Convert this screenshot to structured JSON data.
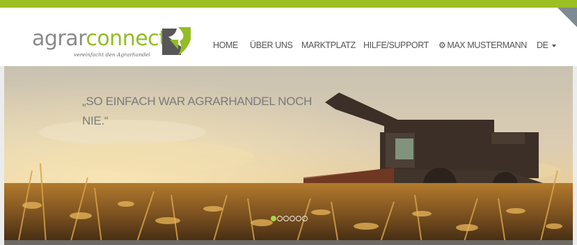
{
  "brand": {
    "name_part1": "agrar",
    "name_part2": "connect",
    "tagline": "vereinfacht den Agrarhandel",
    "accent": "#9cc024",
    "mark_color": "#555555"
  },
  "nav": {
    "items": [
      "HOME",
      "ÜBER UNS",
      "MARKTPLATZ",
      "HILFE/SUPPORT"
    ],
    "user": "MAX MUSTERMANN",
    "language": "DE"
  },
  "hero": {
    "quote_line1": "„SO EINFACH WAR AGRARHANDEL NOCH",
    "quote_line2": "NIE.“",
    "slides_total": 6,
    "active_slide": 1
  },
  "icons": {
    "user": "gear-icon",
    "language": "caret-down-icon",
    "logo": "agrarconnect-logo"
  }
}
